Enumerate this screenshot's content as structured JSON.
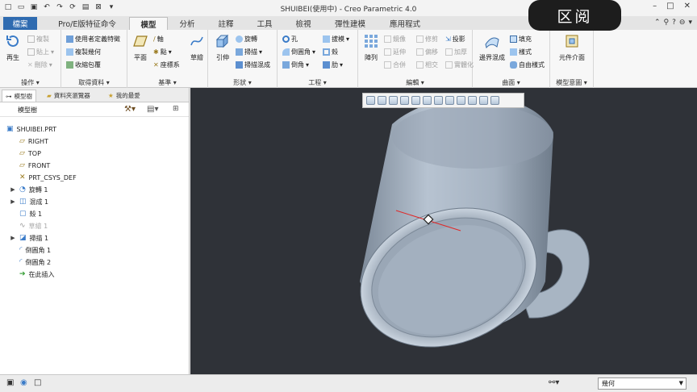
{
  "window": {
    "title": "SHUIBEI(使用中) - Creo Parametric 4.0",
    "watermark": "区阅"
  },
  "tabs": [
    "檔案",
    "Pro/E版特征命令",
    "模型",
    "分析",
    "註釋",
    "工具",
    "檢視",
    "彈性建模",
    "應用程式"
  ],
  "ribbon": {
    "operations": {
      "label": "操作",
      "regen": "再生",
      "copy": "複製",
      "paste": "貼上",
      "delete": "刪除"
    },
    "get_data": {
      "label": "取得資料",
      "udf": "使用者定義特徵",
      "copy_geom": "複製幾何",
      "shrinkwrap": "收縮包覆"
    },
    "datum": {
      "label": "基準",
      "plane": "平面",
      "axis": "軸",
      "point": "點",
      "csys": "座標系",
      "sketch": "草繪"
    },
    "shapes": {
      "label": "形狀",
      "extrude": "引伸",
      "revolve": "旋轉",
      "sweep": "掃描",
      "swept_blend": "掃描混成"
    },
    "engineering": {
      "label": "工程",
      "hole": "孔",
      "round": "倒圓角",
      "chamfer": "倒角",
      "draft": "拔模",
      "shell": "殼",
      "rib": "肋"
    },
    "editing": {
      "label": "編輯",
      "pattern": "陣列",
      "mirror": "鏡像",
      "extend": "延伸",
      "trim": "修剪",
      "offset": "偏移",
      "merge": "合併",
      "intersect": "相交",
      "thicken": "加厚",
      "project": "投影",
      "solidify": "實體化"
    },
    "surfaces": {
      "label": "曲面",
      "boundary": "邊界混成",
      "fill": "填充",
      "style": "樣式",
      "freeform": "自由樣式"
    },
    "intent": {
      "label": "模型意圖",
      "component_interface": "元件介面"
    }
  },
  "panel": {
    "tabs": [
      "模型樹",
      "資料夾瀏覽器",
      "我的最愛"
    ],
    "tree_label": "模型樹",
    "tree": [
      {
        "label": "SHUIBEI.PRT",
        "icon": "part-icon",
        "expandable": false,
        "dim": false
      },
      {
        "label": "RIGHT",
        "icon": "datum-plane-icon",
        "expandable": false,
        "dim": false
      },
      {
        "label": "TOP",
        "icon": "datum-plane-icon",
        "expandable": false,
        "dim": false
      },
      {
        "label": "FRONT",
        "icon": "datum-plane-icon",
        "expandable": false,
        "dim": false
      },
      {
        "label": "PRT_CSYS_DEF",
        "icon": "csys-icon",
        "expandable": false,
        "dim": false
      },
      {
        "label": "旋轉 1",
        "icon": "revolve-icon",
        "expandable": true,
        "dim": false
      },
      {
        "label": "混成 1",
        "icon": "blend-icon",
        "expandable": true,
        "dim": false
      },
      {
        "label": "殼 1",
        "icon": "shell-icon",
        "expandable": false,
        "dim": false
      },
      {
        "label": "草繪 1",
        "icon": "sketch-icon",
        "expandable": false,
        "dim": true
      },
      {
        "label": "掃描 1",
        "icon": "sweep-icon",
        "expandable": true,
        "dim": false
      },
      {
        "label": "倒圓角 1",
        "icon": "round-icon",
        "expandable": false,
        "dim": false
      },
      {
        "label": "倒圓角 2",
        "icon": "round-icon",
        "expandable": false,
        "dim": false
      },
      {
        "label": "在此插入",
        "icon": "insert-here-icon",
        "expandable": false,
        "dim": false
      }
    ]
  },
  "status": {
    "filter": "幾何"
  },
  "colors": {
    "file_tab": "#2f6bb0",
    "viewport_bg": "#2f3238",
    "model": "#a9b6c4"
  }
}
